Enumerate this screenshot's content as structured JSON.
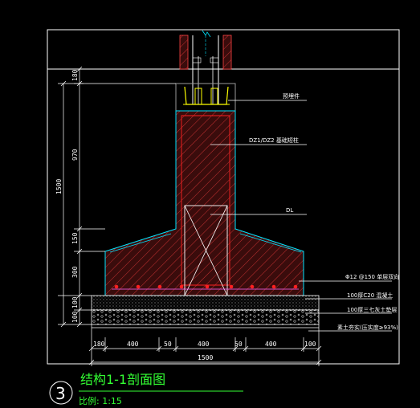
{
  "drawing": {
    "title": "结构1-1剖面图",
    "title_number": "3",
    "scale": "比例: 1:15",
    "colors": {
      "background": "#000000",
      "frame": "#ffffff",
      "outline": "#00e5ff",
      "concrete_hatch": "#ff3333",
      "concrete_fill": "#3a0c0c",
      "rebar": "#ff2020",
      "rebar_line": "#ff66ff",
      "ground": "#ffff00",
      "dimension": "#ffffff",
      "title": "#33ff33"
    },
    "callouts": [
      {
        "id": "anchor",
        "text": "预埋件"
      },
      {
        "id": "column",
        "text": "DZ1/DZ2  基础短柱"
      },
      {
        "id": "beam",
        "text": "DL"
      },
      {
        "id": "rebar",
        "text": "Φ12 @150 单层双向"
      },
      {
        "id": "c20",
        "text": "100厚C20 混凝土"
      },
      {
        "id": "gravel",
        "text": "100厚三七灰土垫层"
      },
      {
        "id": "soil",
        "text": "素土夯实(压实度≥93%)"
      }
    ],
    "vertical_dims_inner": [
      "180",
      "970",
      "150",
      "300",
      "100",
      "100"
    ],
    "vertical_dim_total": "1500",
    "horizontal_dims": [
      "180",
      "400",
      "50",
      "400",
      "50",
      "400",
      "100"
    ],
    "horizontal_dim_total": "1500"
  }
}
